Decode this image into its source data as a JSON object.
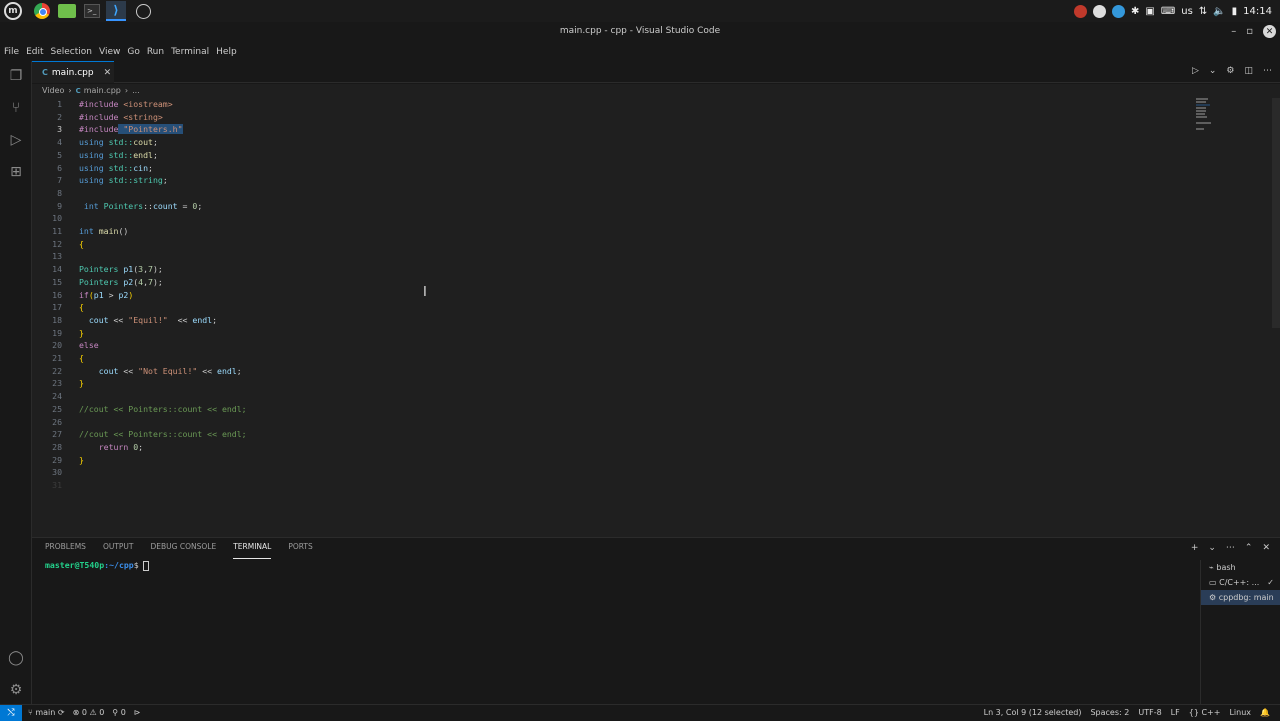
{
  "os_bar": {
    "keyboard_layout": "us",
    "time": "14:14"
  },
  "window": {
    "title": "main.cpp - cpp - Visual Studio Code"
  },
  "menu": [
    "File",
    "Edit",
    "Selection",
    "View",
    "Go",
    "Run",
    "Terminal",
    "Help"
  ],
  "editor_tab": {
    "label": "main.cpp",
    "lang_icon": "C"
  },
  "breadcrumb": {
    "folder": "Video",
    "file": "main.cpp",
    "more": "..."
  },
  "code_lines": [
    {
      "n": "1"
    },
    {
      "n": "2"
    },
    {
      "n": "3"
    },
    {
      "n": "4"
    },
    {
      "n": "5"
    },
    {
      "n": "6"
    },
    {
      "n": "7"
    },
    {
      "n": "8"
    },
    {
      "n": "9"
    },
    {
      "n": "10"
    },
    {
      "n": "11"
    },
    {
      "n": "12"
    },
    {
      "n": "13"
    },
    {
      "n": "14"
    },
    {
      "n": "15"
    },
    {
      "n": "16"
    },
    {
      "n": "17"
    },
    {
      "n": "18"
    },
    {
      "n": "19"
    },
    {
      "n": "20"
    },
    {
      "n": "21"
    },
    {
      "n": "22"
    },
    {
      "n": "23"
    },
    {
      "n": "24"
    },
    {
      "n": "25"
    },
    {
      "n": "26"
    },
    {
      "n": "27"
    },
    {
      "n": "28"
    },
    {
      "n": "29"
    },
    {
      "n": "30"
    },
    {
      "n": "31"
    }
  ],
  "code": {
    "l1": [
      "#include",
      " <iostream>"
    ],
    "l2": [
      "#include",
      " <string>"
    ],
    "l3": [
      "#include",
      " \"Pointers.h\""
    ],
    "l4": [
      "using",
      " std::",
      "cout",
      ";"
    ],
    "l5": [
      "using",
      " std::",
      "endl",
      ";"
    ],
    "l6": [
      "using",
      " std::",
      "cin",
      ";"
    ],
    "l7": [
      "using",
      " std::",
      "string",
      ";"
    ],
    "l9": [
      " int",
      " Pointers",
      "::",
      "count",
      " = ",
      "0",
      ";"
    ],
    "l11": [
      "int",
      " main",
      "()"
    ],
    "l12": [
      "{"
    ],
    "l14": [
      "Pointers",
      " p1",
      "(",
      "3",
      ",",
      "7",
      ");"
    ],
    "l15": [
      "Pointers",
      " p2",
      "(",
      "4",
      ",",
      "7",
      ");"
    ],
    "l16": [
      "if",
      "(",
      "p1",
      " > ",
      "p2",
      ")"
    ],
    "l17": [
      "{"
    ],
    "l18": [
      "  cout",
      " << ",
      "\"Equil!\"",
      "  << ",
      "endl",
      ";"
    ],
    "l19": [
      "}"
    ],
    "l20": [
      "else"
    ],
    "l21": [
      "{"
    ],
    "l22": [
      "    cout",
      " << ",
      "\"Not Equil!\"",
      " << ",
      "endl",
      ";"
    ],
    "l23": [
      "}"
    ],
    "l25": [
      "//cout << Pointers::count << endl;"
    ],
    "l27": [
      "//cout << Pointers::count << endl;"
    ],
    "l28": [
      "    return",
      " ",
      "0",
      ";"
    ],
    "l29": [
      "}"
    ]
  },
  "panel": {
    "tabs": [
      "PROBLEMS",
      "OUTPUT",
      "DEBUG CONSOLE",
      "TERMINAL",
      "PORTS"
    ],
    "active_tab": "TERMINAL",
    "prompt_user": "master@T540p",
    "prompt_path": ":~/cpp",
    "prompt_sym": "$",
    "terminals": [
      "bash",
      "C/C++: ...",
      "cppdbg: main"
    ]
  },
  "status": {
    "branch": "main",
    "errors": "0",
    "warnings": "0",
    "ports": "0",
    "position": "Ln 3, Col 9 (12 selected)",
    "spaces": "Spaces: 2",
    "encoding": "UTF-8",
    "eol": "LF",
    "language": "C++",
    "os": "Linux"
  }
}
